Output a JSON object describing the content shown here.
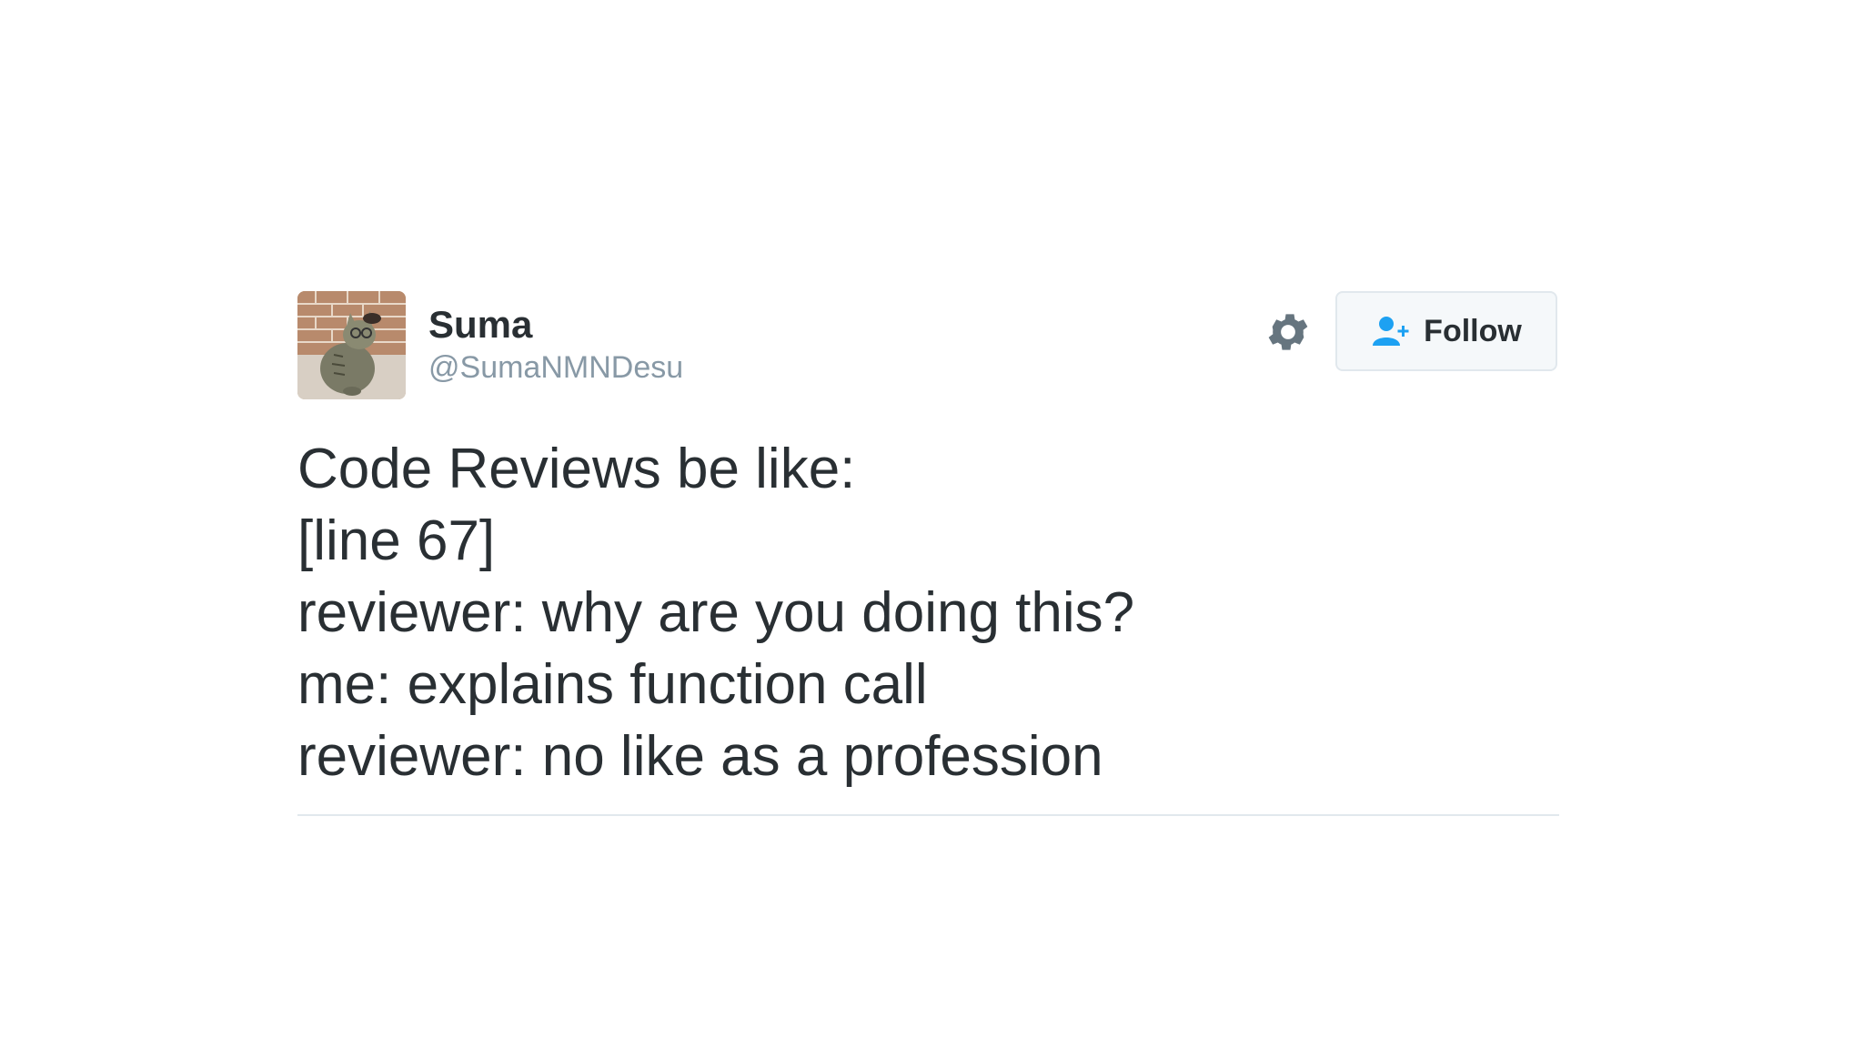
{
  "user": {
    "display_name": "Suma",
    "handle": "@SumaNMNDesu",
    "avatar_icon": "cat-avatar"
  },
  "actions": {
    "settings_icon": "gear-icon",
    "follow_label": "Follow",
    "follow_icon": "add-user-icon"
  },
  "tweet": {
    "lines": [
      "Code Reviews be like:",
      "[line 67]",
      "reviewer: why are you doing this?",
      "me: explains function call",
      "reviewer: no like as a profession"
    ]
  },
  "colors": {
    "text": "#292f33",
    "handle": "#8899a6",
    "accent": "#1da1f2",
    "icon": "#66757f",
    "border": "#e1e8ed"
  }
}
